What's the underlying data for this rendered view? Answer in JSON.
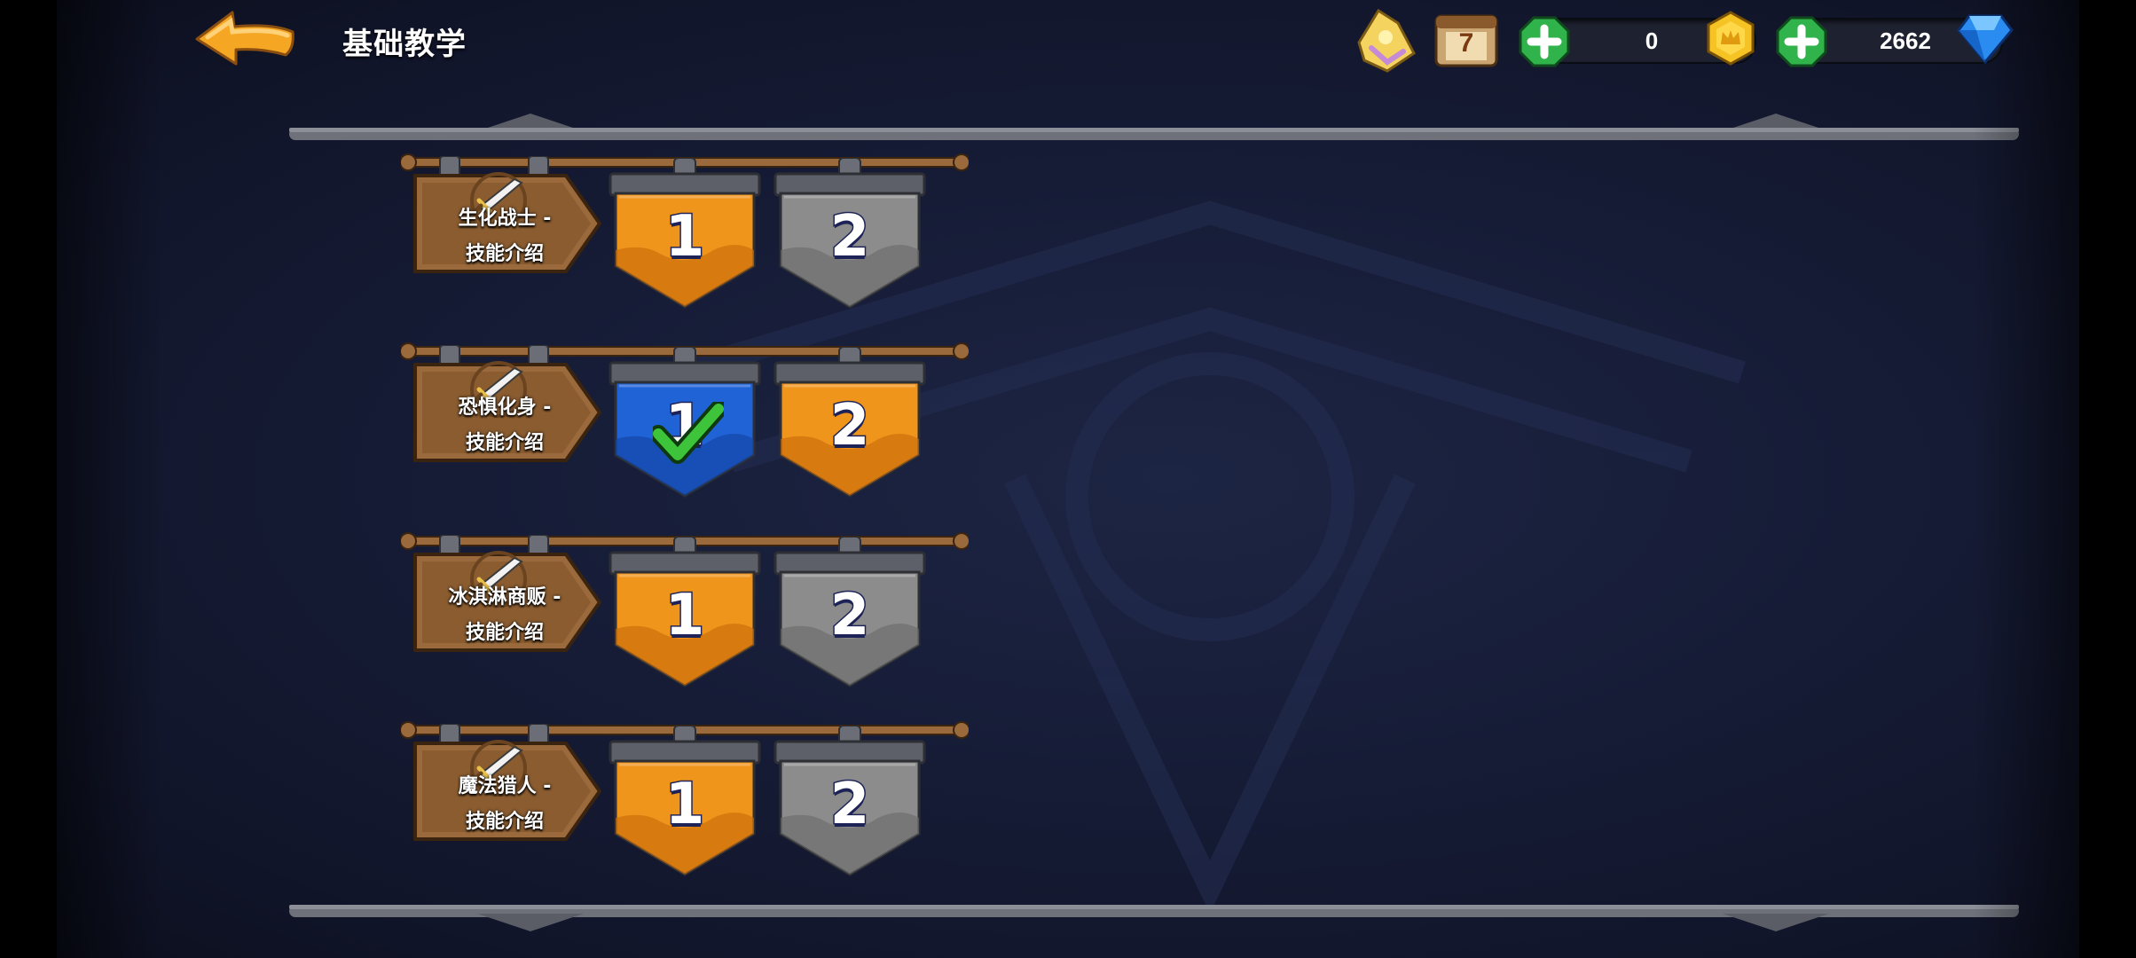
{
  "header": {
    "title": "基础教学",
    "back_icon": "back-arrow-icon",
    "event_icon": "trophy-horn-icon",
    "calendar": {
      "icon": "calendar-icon",
      "day": "7"
    },
    "gold": {
      "value": "0",
      "icon": "gold-crown-coin-icon",
      "add_icon": "plus-icon"
    },
    "gems": {
      "value": "2662",
      "icon": "blue-diamond-icon",
      "add_icon": "plus-icon"
    }
  },
  "rows": [
    {
      "line1": "生化战士 -",
      "line2": "技能介绍",
      "levels": [
        {
          "label": "1",
          "state": "available"
        },
        {
          "label": "2",
          "state": "locked"
        }
      ]
    },
    {
      "line1": "恐惧化身 -",
      "line2": "技能介绍",
      "levels": [
        {
          "label": "1",
          "state": "completed"
        },
        {
          "label": "2",
          "state": "available"
        }
      ]
    },
    {
      "line1": "冰淇淋商贩 -",
      "line2": "技能介绍",
      "levels": [
        {
          "label": "1",
          "state": "available"
        },
        {
          "label": "2",
          "state": "locked"
        }
      ]
    },
    {
      "line1": "魔法猎人 -",
      "line2": "技能介绍",
      "levels": [
        {
          "label": "1",
          "state": "available"
        },
        {
          "label": "2",
          "state": "locked"
        }
      ]
    }
  ],
  "colors": {
    "available": "#f0951c",
    "locked": "#8c8c8c",
    "completed": "#1f63d6",
    "check": "#3dc43a",
    "wood": "#9a6a3c"
  }
}
